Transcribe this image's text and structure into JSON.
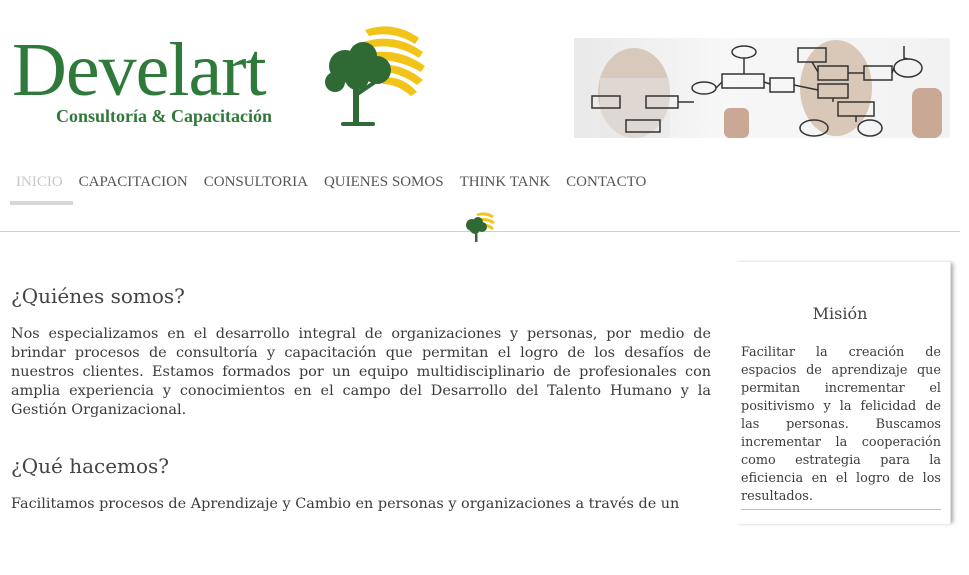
{
  "brand": {
    "name": "Develart",
    "tagline": "Consultoría & Capacitación",
    "green": "#2f7a3a",
    "gold": "#f2c419"
  },
  "nav": {
    "items": [
      "INICIO",
      "CAPACITACION",
      "CONSULTORIA",
      "QUIENES SOMOS",
      "THINK TANK",
      "CONTACTO"
    ],
    "active": "INICIO"
  },
  "main": {
    "section1": {
      "title": "¿Quiénes somos?",
      "text": "Nos especializamos en el desarrollo integral de organizaciones y personas, por medio de brindar procesos de consultoría y capacitación que permitan el logro de los desafíos de nuestros clientes. Estamos formados por un equipo multidisciplinario de profesionales con amplia experiencia y conocimientos en el campo del Desarrollo del Talento Humano y la Gestión Organizacional."
    },
    "section2": {
      "title": "¿Qué hacemos?",
      "text": "Facilitamos procesos de Aprendizaje y Cambio en personas y organizaciones a través de un"
    }
  },
  "sidebar": {
    "title": "Misión",
    "text": "Facilitar la creación de espacios de aprendizaje que permitan incrementar el positivismo y la felicidad de las personas. Buscamos incrementar la cooperación como estrategia para la eficiencia en el logro de los resultados."
  },
  "icons": {
    "logo": "tree-sun-logo-icon",
    "banner": "flowchart-banner-image",
    "divider_ornament": "tree-sun-logo-icon"
  }
}
